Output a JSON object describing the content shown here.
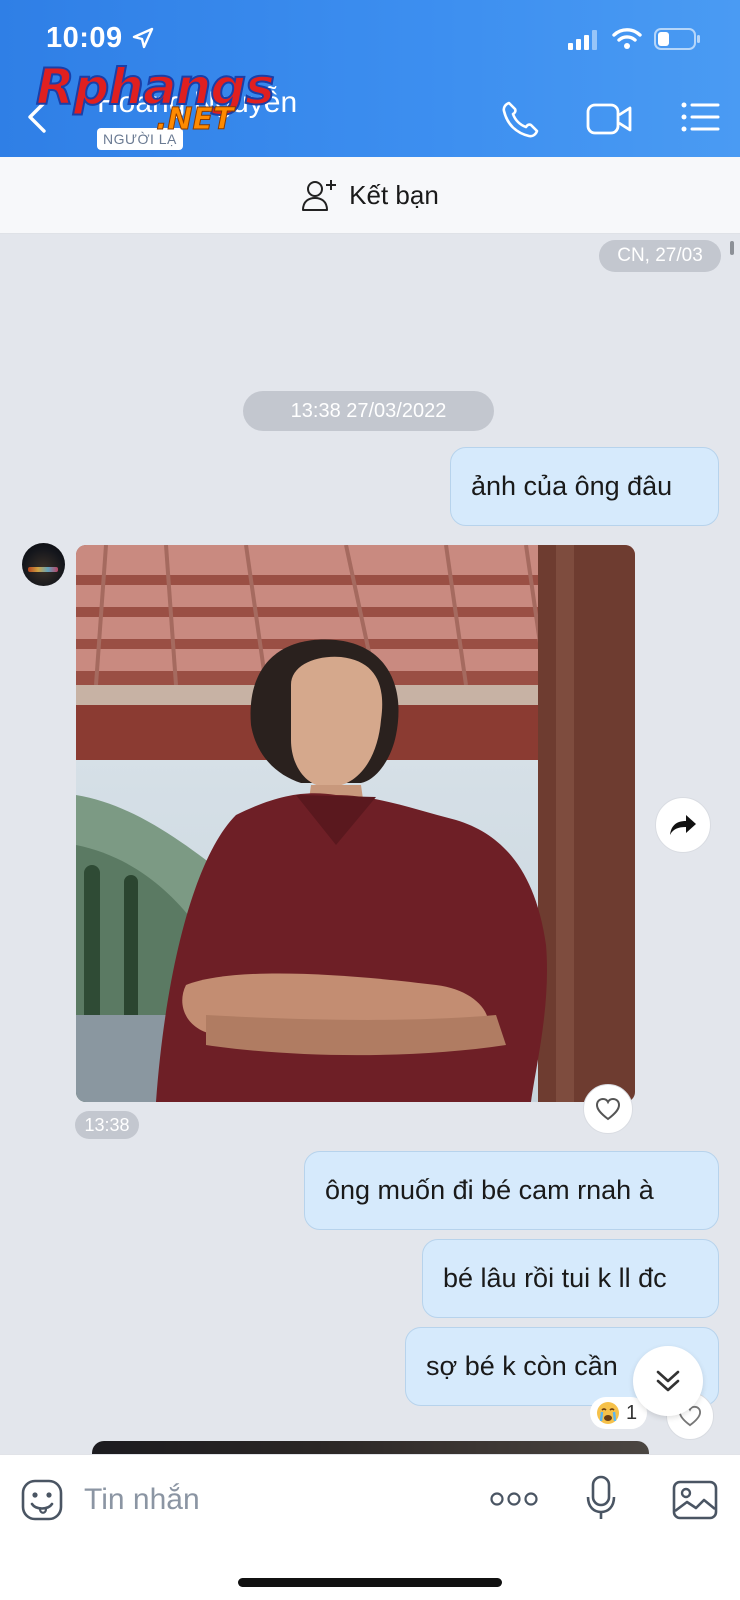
{
  "status_bar": {
    "time": "10:09"
  },
  "header": {
    "contact_name": "Hoang Nguyễn",
    "badge": "NGƯỜI LẠ",
    "watermark_main": "Rphangs",
    "watermark_net": ".NET"
  },
  "add_friend": {
    "label": "Kết bạn"
  },
  "conversation": {
    "date_divider": "CN, 27/03",
    "time_divider": "13:38 27/03/2022",
    "messages": [
      {
        "text": "ảnh của ông đâu"
      },
      {
        "text": "ông muốn đi bé cam rnah à"
      },
      {
        "text": "bé lâu rồi tui k ll đc"
      },
      {
        "text": "sợ bé k còn cần"
      }
    ],
    "photo_time": "13:38",
    "reaction_count": "1"
  },
  "composer": {
    "placeholder": "Tin nhắn"
  },
  "colors": {
    "header_blue": "#3d8ff0",
    "bubble_out": "#d6eafc",
    "background": "#e3e6ec"
  }
}
